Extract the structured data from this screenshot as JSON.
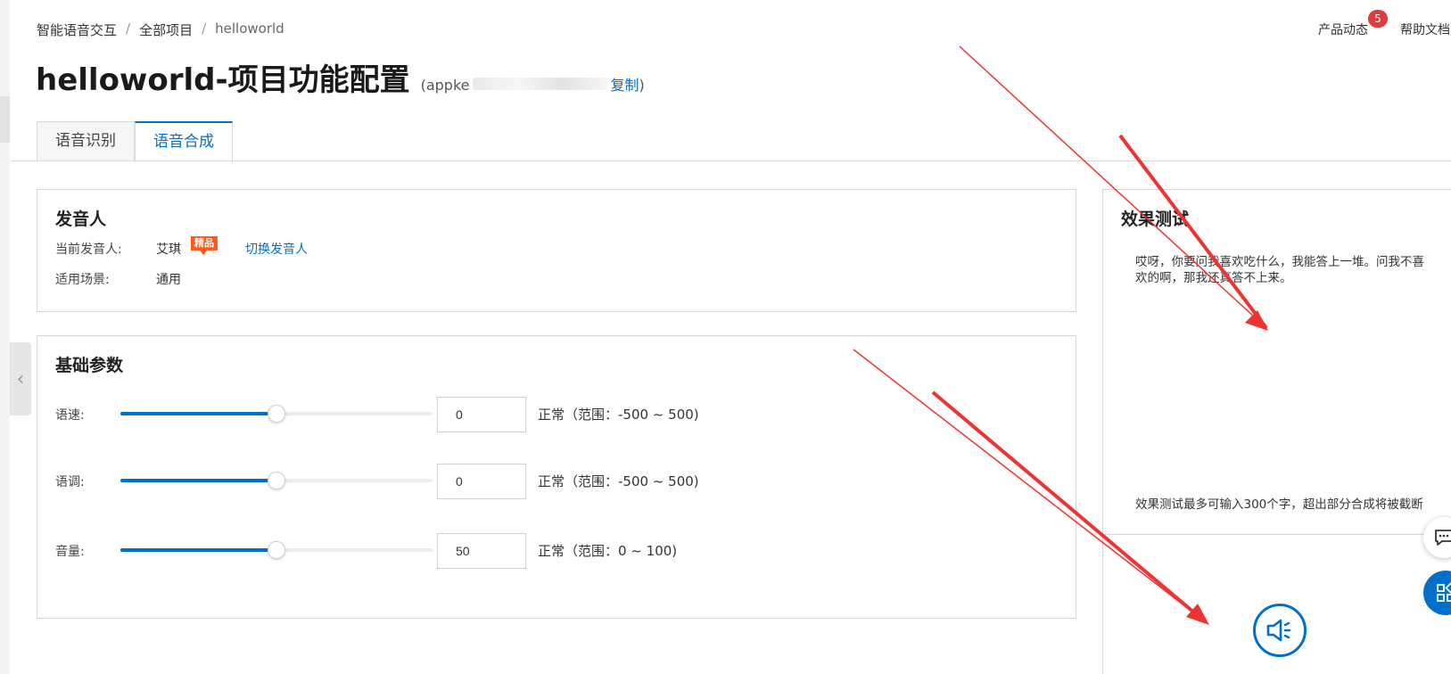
{
  "breadcrumb": {
    "root": "智能语音交互",
    "projects": "全部项目",
    "current": "helloworld",
    "separator": "/"
  },
  "top_nav": {
    "news_label": "产品动态",
    "news_badge": "5",
    "help_label": "帮助文档"
  },
  "header": {
    "title": "helloworld-项目功能配置",
    "appkey_prefix": "(appke",
    "copy_label": "复制",
    "appkey_suffix": ")"
  },
  "tabs": [
    {
      "label": "语音识别",
      "active": false
    },
    {
      "label": "语音合成",
      "active": true
    }
  ],
  "speaker_card": {
    "title": "发音人",
    "current_label": "当前发音人:",
    "current_value": "艾琪",
    "tag": "精品",
    "switch_label": "切换发音人",
    "scene_label": "适用场景:",
    "scene_value": "通用"
  },
  "params_card": {
    "title": "基础参数",
    "params": [
      {
        "label": "语速:",
        "value": "0",
        "level": 0.5,
        "range_text": "正常（范围：-500 ~ 500)"
      },
      {
        "label": "语调:",
        "value": "0",
        "level": 0.5,
        "range_text": "正常（范围：-500 ~ 500)"
      },
      {
        "label": "音量:",
        "value": "50",
        "level": 0.5,
        "range_text": "正常（范围：0 ~ 100)"
      }
    ]
  },
  "test_panel": {
    "title": "效果测试",
    "sample_text": "哎呀，你要问我喜欢吃什么，我能答上一堆。问我不喜欢的啊，那我还真答不上来。",
    "limit_note": "效果测试最多可输入300个字，超出部分合成将被截断"
  },
  "icons": {
    "collapse": "chevron-left-icon",
    "play": "speaker-icon",
    "chat": "chat-icon",
    "apps": "apps-grid-icon"
  },
  "colors": {
    "primary": "#0070cc",
    "badge": "#e4393c",
    "tag": "#ff5a1f",
    "annotation_arrow": "#ee3333"
  }
}
